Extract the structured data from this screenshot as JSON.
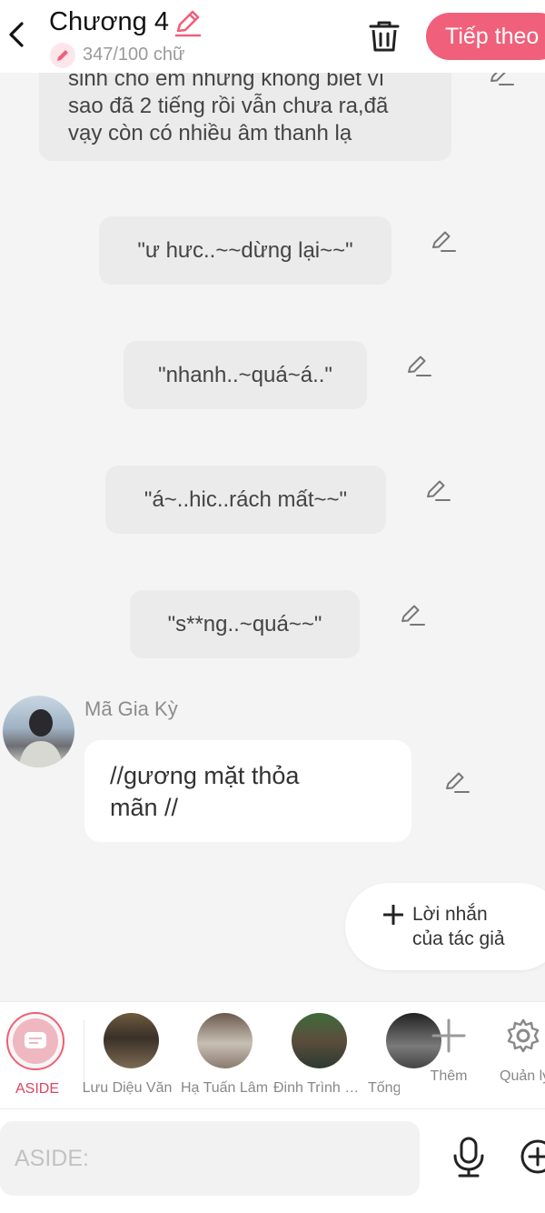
{
  "header": {
    "title": "Chương 4",
    "word_count": "347/100 chữ",
    "next_label": "Tiếp theo",
    "accent_color": "#f0607a"
  },
  "chat": {
    "top_bubble_lines": [
      "sinh cho em nhưng không biết vì",
      "sao đã 2 tiếng rồi vẫn chưa ra,đã",
      "vạy còn có nhiều âm thanh lạ"
    ],
    "aside_messages": [
      "\"ư hưc..~~dừng lại~~\"",
      "\"nhanh..~quá~á..\"",
      "\"á~..hic..rách mất~~\"",
      "\"s**ng..~quá~~\""
    ],
    "character_message": {
      "speaker": "Mã Gia Kỳ",
      "lines": [
        "//gương mặt thỏa",
        "mãn //"
      ]
    },
    "author_note": {
      "line1": "Lời nhắn",
      "line2": "của tác giả"
    }
  },
  "character_bar": {
    "aside_label": "ASIDE",
    "characters": [
      {
        "name": "Lưu Diệu Văn"
      },
      {
        "name": "Hạ Tuấn Lâm"
      },
      {
        "name": "Đinh Trình Hâm"
      },
      {
        "name": "Tống"
      }
    ],
    "add_label": "Thêm",
    "manage_label": "Quản lý"
  },
  "input": {
    "placeholder": "ASIDE:",
    "value": ""
  }
}
